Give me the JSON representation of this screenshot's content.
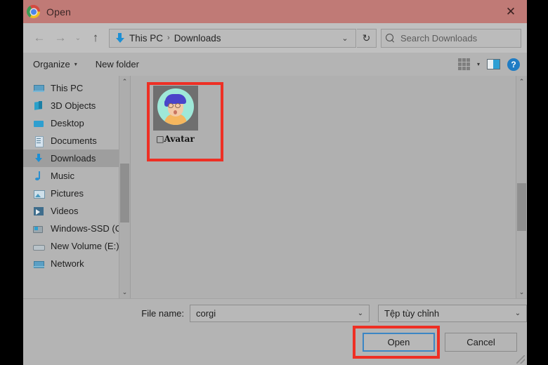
{
  "window": {
    "title": "Open",
    "app_icon": "chrome-logo",
    "close_label": "✕",
    "titlebar_color": "#c07a76"
  },
  "nav": {
    "back": "←",
    "forward": "→",
    "recent": "⌄",
    "up": "↑",
    "refresh": "↻",
    "address_icon": "downloads-arrow-icon",
    "breadcrumbs": [
      "This PC",
      "Downloads"
    ],
    "separator": "›",
    "dropdown_caret": "⌄"
  },
  "search": {
    "placeholder": "Search Downloads",
    "icon": "search-icon"
  },
  "toolbar": {
    "organize_label": "Organize",
    "organize_caret": "▾",
    "new_folder_label": "New folder",
    "view_icon": "view-grid-icon",
    "view_caret": "▾",
    "preview_pane_icon": "preview-pane-icon",
    "help_icon": "help-icon",
    "help_glyph": "?"
  },
  "sidebar": {
    "items": [
      {
        "label": "This PC",
        "icon": "ic-pc",
        "selected": false
      },
      {
        "label": "3D Objects",
        "icon": "ic-3d",
        "selected": false
      },
      {
        "label": "Desktop",
        "icon": "ic-desktop",
        "selected": false
      },
      {
        "label": "Documents",
        "icon": "ic-docs",
        "selected": false
      },
      {
        "label": "Downloads",
        "icon": "ic-dl",
        "selected": true
      },
      {
        "label": "Music",
        "icon": "ic-music",
        "selected": false
      },
      {
        "label": "Pictures",
        "icon": "ic-pics",
        "selected": false
      },
      {
        "label": "Videos",
        "icon": "ic-vids",
        "selected": false
      },
      {
        "label": "Windows-SSD (C",
        "icon": "ic-drive",
        "selected": false
      },
      {
        "label": "New Volume (E:)",
        "icon": "ic-vol",
        "selected": false
      },
      {
        "label": "Network",
        "icon": "ic-net",
        "selected": false
      }
    ],
    "scroll_up": "⌃",
    "scroll_down": "⌄"
  },
  "filelist": {
    "files": [
      {
        "label": "□Avatar",
        "thumbnail": "avatar-image"
      }
    ],
    "scroll_up": "⌃",
    "scroll_down": "⌄"
  },
  "bottom": {
    "filename_label": "File name:",
    "filename_value": "corgi",
    "filetype_value": "Tệp tùy chỉnh",
    "caret": "⌄",
    "open_label": "Open",
    "cancel_label": "Cancel"
  },
  "annotations": {
    "color": "#ee2f24",
    "boxes": [
      "file-avatar-highlight",
      "open-button-highlight"
    ]
  }
}
